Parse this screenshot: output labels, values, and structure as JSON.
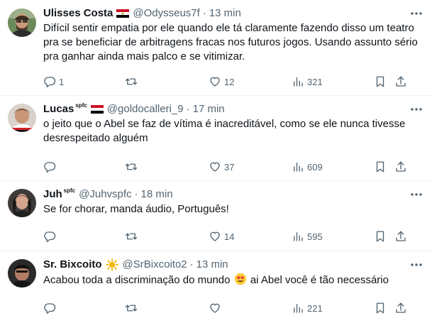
{
  "tweets": [
    {
      "name": "Ulisses Costa",
      "badge": "",
      "handle": "@Odysseus7f",
      "separator": "·",
      "time": "13 min",
      "text": "Difícil sentir empatia por ele quando ele tá claramente fazendo disso um teatro pra se beneficiar de arbitragens fracas nos futuros jogos. Usando assunto sério pra ganhar ainda mais palco e se vitimizar.",
      "replies": "1",
      "retweets": "",
      "likes": "12",
      "views": "321"
    },
    {
      "name": "Lucas",
      "badge": "spfc",
      "handle": "@goldocalleri_9",
      "separator": "·",
      "time": "17 min",
      "text": "o jeito que o Abel se faz de vítima é inacreditável, como se ele nunca tivesse desrespeitado alguém",
      "replies": "",
      "retweets": "",
      "likes": "37",
      "views": "609"
    },
    {
      "name": "Juh",
      "badge": "spfc",
      "handle": "@Juhvspfc",
      "separator": "·",
      "time": "18 min",
      "text": "Se for chorar, manda áudio, Português!",
      "replies": "",
      "retweets": "",
      "likes": "14",
      "views": "595"
    },
    {
      "name": "Sr. Bixcoito",
      "badge": "",
      "handle": "@SrBixcoito2",
      "separator": "·",
      "time": "13 min",
      "text_before": "Acabou toda a discriminação do mundo",
      "text_after": "ai Abel você é tão necessário",
      "replies": "",
      "retweets": "",
      "likes": "",
      "views": "221"
    }
  ],
  "colors": {
    "text": "#0f1419",
    "secondary": "#536471",
    "divider": "#eff3f4",
    "spfc_red": "#d2232a",
    "sun": "#f5b400"
  },
  "icons": [
    "reply-icon",
    "retweet-icon",
    "like-icon",
    "views-icon",
    "bookmark-icon",
    "share-icon",
    "more-icon",
    "flag-icon",
    "sun-emoji",
    "heart-eyes-emoji"
  ]
}
